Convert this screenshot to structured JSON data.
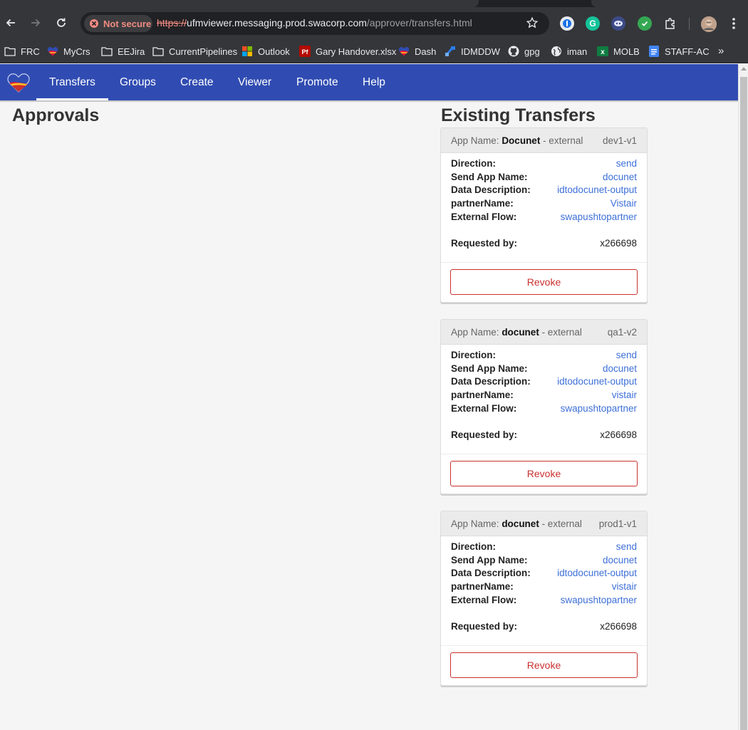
{
  "browser": {
    "security_label": "Not secure",
    "url_scheme": "https://",
    "url_host": "ufmviewer.messaging.prod.swacorp.com",
    "url_path": "/approver/transfers.html"
  },
  "bookmarks": [
    {
      "label": "FRC",
      "icon": "folder-icon"
    },
    {
      "label": "MyCrs",
      "icon": "heart-logo-icon"
    },
    {
      "label": "EEJira",
      "icon": "folder-icon"
    },
    {
      "label": "CurrentPipelines",
      "icon": "folder-icon"
    },
    {
      "label": "Outlook",
      "icon": "windows-logo-icon"
    },
    {
      "label": "Gary Handover.xlsx",
      "icon": "pdf-icon"
    },
    {
      "label": "Dash",
      "icon": "heart-logo-icon"
    },
    {
      "label": "IDMDDW",
      "icon": "diagram-icon"
    },
    {
      "label": "gpg",
      "icon": "github-icon"
    },
    {
      "label": "iman",
      "icon": "globe-icon"
    },
    {
      "label": "MOLB",
      "icon": "excel-icon"
    },
    {
      "label": "STAFF-AC",
      "icon": "docs-icon"
    }
  ],
  "nav": {
    "items": [
      {
        "label": "Transfers",
        "active": true
      },
      {
        "label": "Groups"
      },
      {
        "label": "Create"
      },
      {
        "label": "Viewer"
      },
      {
        "label": "Promote"
      },
      {
        "label": "Help"
      }
    ]
  },
  "approvals": {
    "title": "Approvals"
  },
  "existing": {
    "title": "Existing Transfers",
    "cards": [
      {
        "app_label": "App Name:",
        "app_name": "Docunet",
        "app_type": " - external",
        "env": "dev1-v1",
        "fields": [
          {
            "label": "Direction:",
            "value": "send"
          },
          {
            "label": "Send App Name:",
            "value": "docunet"
          },
          {
            "label": "Data Description:",
            "value": "idtodocunet-output"
          },
          {
            "label": "partnerName:",
            "value": "Vistair"
          },
          {
            "label": "External Flow:",
            "value": "swapushtopartner"
          }
        ],
        "requested_label": "Requested by:",
        "requested_by": "x266698",
        "revoke_label": "Revoke"
      },
      {
        "app_label": "App Name:",
        "app_name": "docunet",
        "app_type": " - external",
        "env": "qa1-v2",
        "fields": [
          {
            "label": "Direction:",
            "value": "send"
          },
          {
            "label": "Send App Name:",
            "value": "docunet"
          },
          {
            "label": "Data Description:",
            "value": "idtodocunet-output"
          },
          {
            "label": "partnerName:",
            "value": "vistair"
          },
          {
            "label": "External Flow:",
            "value": "swapushtopartner"
          }
        ],
        "requested_label": "Requested by:",
        "requested_by": "x266698",
        "revoke_label": "Revoke"
      },
      {
        "app_label": "App Name:",
        "app_name": "docunet",
        "app_type": " - external",
        "env": "prod1-v1",
        "fields": [
          {
            "label": "Direction:",
            "value": "send"
          },
          {
            "label": "Send App Name:",
            "value": "docunet"
          },
          {
            "label": "Data Description:",
            "value": "idtodocunet-output"
          },
          {
            "label": "partnerName:",
            "value": "vistair"
          },
          {
            "label": "External Flow:",
            "value": "swapushtopartner"
          }
        ],
        "requested_label": "Requested by:",
        "requested_by": "x266698",
        "revoke_label": "Revoke"
      }
    ]
  },
  "colors": {
    "nav_bg": "#304cb2",
    "link": "#3d6fd8",
    "revoke": "#c8312e",
    "not_secure": "#f28b82"
  }
}
